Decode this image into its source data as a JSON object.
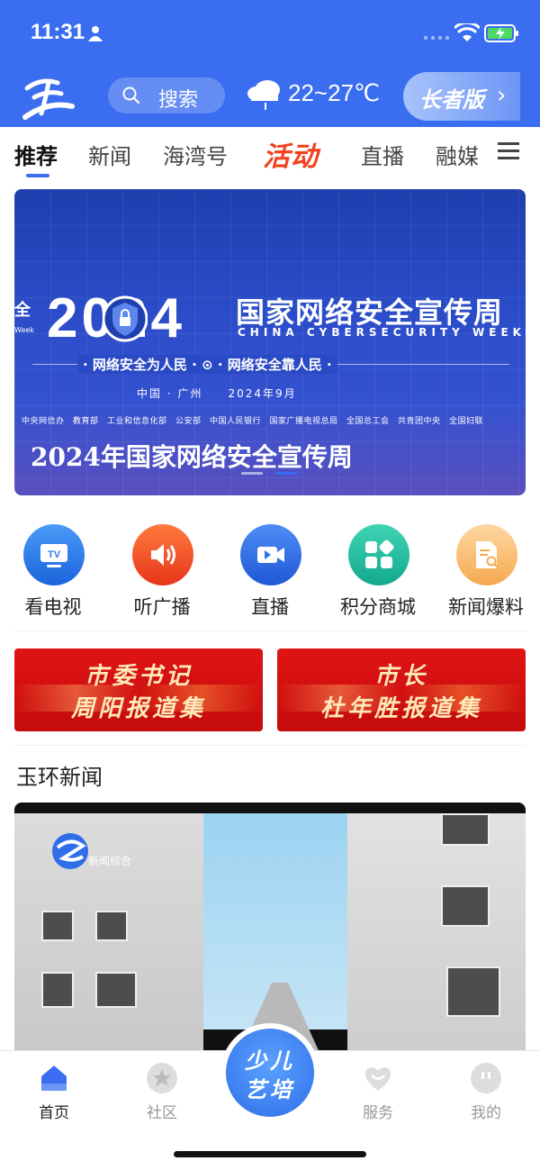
{
  "status_bar": {
    "time": "11:31"
  },
  "header": {
    "search_placeholder": "搜索",
    "temperature": "22~27℃",
    "elder_mode_label": "长者版",
    "elder_mode_chevron": "›"
  },
  "tabs": [
    {
      "label": "推荐",
      "active": true
    },
    {
      "label": "新闻"
    },
    {
      "label": "海湾号"
    },
    {
      "label": "活动"
    },
    {
      "label": "直播"
    },
    {
      "label": "融媒"
    }
  ],
  "banner": {
    "side_text": "全",
    "side_small": "Week",
    "year": "2024",
    "title_cn": "国家网络安全宣传周",
    "title_en": "CHINA CYBERSECURITY WEEK",
    "slogan": "· 网络安全为人民 · ⊙ · 网络安全靠人民 ·",
    "location_date": "中国 · 广州　　2024年9月",
    "organizers": "中央网信办　教育部　工业和信息化部　公安部　中国人民银行　国家广播电视总局　全国总工会　共青团中央　全国妇联",
    "caption": "2024年国家网络安全宣传周",
    "dots_count": 2,
    "active_dot": 1
  },
  "shortcuts": [
    {
      "label": "看电视",
      "icon": "tv-icon",
      "color": "#2b7bec"
    },
    {
      "label": "听广播",
      "icon": "speaker-icon",
      "color": "#f0501f"
    },
    {
      "label": "直播",
      "icon": "video-camera-icon",
      "color": "#2d72e8"
    },
    {
      "label": "积分商城",
      "icon": "apps-grid-icon",
      "color": "#21bfa0"
    },
    {
      "label": "新闻爆料",
      "icon": "document-search-icon",
      "color": "#f6b25a"
    }
  ],
  "promo_buttons": [
    {
      "line1": "市委书记",
      "line2": "周阳报道集"
    },
    {
      "line1": "市长",
      "line2": "杜年胜报道集"
    }
  ],
  "section": {
    "title": "玉环新闻"
  },
  "video": {
    "channel_label": "新闻综合"
  },
  "bottom_nav": [
    {
      "label": "首页",
      "icon": "home-icon",
      "active": true
    },
    {
      "label": "社区",
      "icon": "community-star-icon"
    },
    {
      "label": "服务",
      "icon": "heart-service-icon"
    },
    {
      "label": "我的",
      "icon": "profile-icon"
    }
  ],
  "center_button": {
    "line1": "少儿",
    "line2": "艺培"
  },
  "colors": {
    "brand_blue": "#3a6df0",
    "hot_red": "#f2401f",
    "promo_red": "#d81010"
  }
}
